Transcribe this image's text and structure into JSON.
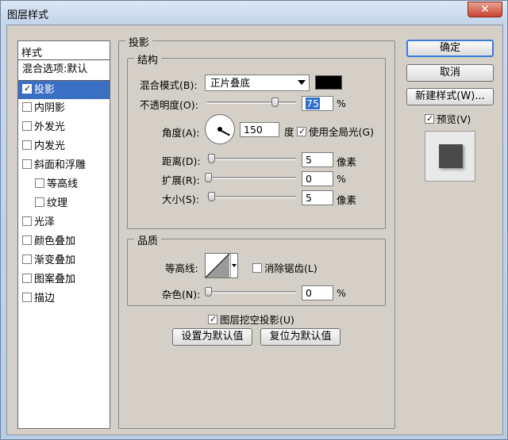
{
  "window": {
    "title": "图层样式",
    "close": "✕"
  },
  "stylelist": {
    "header": "样式",
    "blend_options": "混合选项:默认",
    "items": [
      {
        "label": "投影",
        "checked": true,
        "selected": true
      },
      {
        "label": "内阴影",
        "checked": false
      },
      {
        "label": "外发光",
        "checked": false
      },
      {
        "label": "内发光",
        "checked": false
      },
      {
        "label": "斜面和浮雕",
        "checked": false
      },
      {
        "label": "等高线",
        "checked": false,
        "sub": true
      },
      {
        "label": "纹理",
        "checked": false,
        "sub": true
      },
      {
        "label": "光泽",
        "checked": false
      },
      {
        "label": "颜色叠加",
        "checked": false
      },
      {
        "label": "渐变叠加",
        "checked": false
      },
      {
        "label": "图案叠加",
        "checked": false
      },
      {
        "label": "描边",
        "checked": false
      }
    ]
  },
  "drop_shadow": {
    "legend": "投影",
    "structure": {
      "legend": "结构",
      "blend_mode_label": "混合模式(B):",
      "blend_mode_value": "正片叠底",
      "shadow_color": "#000000",
      "opacity_label": "不透明度(O):",
      "opacity_value": "75",
      "opacity_unit": "%",
      "angle_label": "角度(A):",
      "angle_value": "150",
      "angle_unit": "度",
      "global_light_label": "使用全局光(G)",
      "global_light_checked": true,
      "distance_label": "距离(D):",
      "distance_value": "5",
      "distance_unit": "像素",
      "spread_label": "扩展(R):",
      "spread_value": "0",
      "spread_unit": "%",
      "size_label": "大小(S):",
      "size_value": "5",
      "size_unit": "像素"
    },
    "quality": {
      "legend": "品质",
      "contour_label": "等高线:",
      "anti_alias_label": "消除锯齿(L)",
      "anti_alias_checked": false,
      "noise_label": "杂色(N):",
      "noise_value": "0",
      "noise_unit": "%"
    },
    "knockout_label": "图层挖空投影(U)",
    "knockout_checked": true,
    "make_default": "设置为默认值",
    "reset_default": "复位为默认值"
  },
  "buttons": {
    "ok": "确定",
    "cancel": "取消",
    "new_style": "新建样式(W)...",
    "preview_label": "预览(V)",
    "preview_checked": true
  }
}
